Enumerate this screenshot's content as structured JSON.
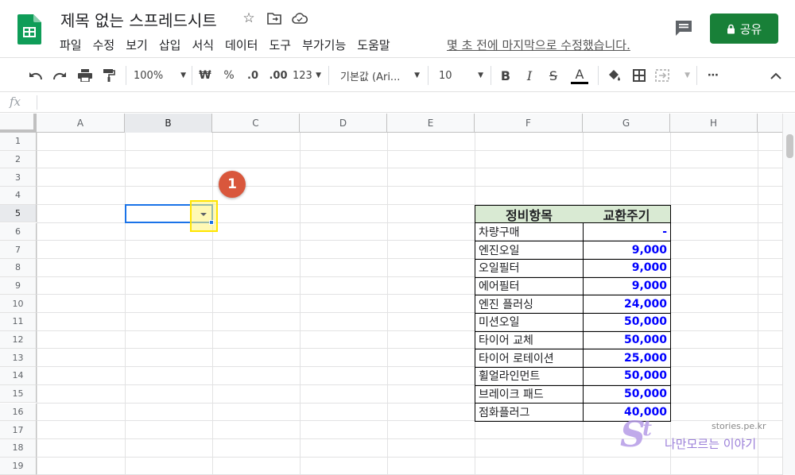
{
  "app": {
    "doc_title": "제목 없는 스프레드시트",
    "last_edit": "몇 초 전에 마지막으로 수정했습니다.",
    "share_label": "공유",
    "menu": [
      "파일",
      "수정",
      "보기",
      "삽입",
      "서식",
      "데이터",
      "도구",
      "부가기능",
      "도움말"
    ]
  },
  "toolbar": {
    "zoom": "100%",
    "currency": "₩",
    "percent": "%",
    "dec_decrease": ".0",
    "dec_increase": ".00",
    "more_formats": "123",
    "font": "기본값 (Ari...",
    "font_size": "10",
    "bold": "B",
    "italic": "I",
    "strike": "S",
    "text_color": "A",
    "more": "⋯"
  },
  "formula_bar": {
    "fx": "fx",
    "value": ""
  },
  "columns": [
    "A",
    "B",
    "C",
    "D",
    "E",
    "F",
    "G",
    "H"
  ],
  "rows": [
    "1",
    "2",
    "3",
    "4",
    "5",
    "6",
    "7",
    "8",
    "9",
    "10",
    "11",
    "12",
    "13",
    "14",
    "15",
    "16",
    "17",
    "18",
    "19"
  ],
  "selected": {
    "column": "B",
    "row": "5"
  },
  "table": {
    "headers": [
      "정비항목",
      "교환주기"
    ],
    "rows": [
      [
        "차량구매",
        "-"
      ],
      [
        "엔진오일",
        "9,000"
      ],
      [
        "오일필터",
        "9,000"
      ],
      [
        "에어필터",
        "9,000"
      ],
      [
        "엔진 플러싱",
        "24,000"
      ],
      [
        "미션오일",
        "50,000"
      ],
      [
        "타이어 교체",
        "50,000"
      ],
      [
        "타이어 로테이션",
        "25,000"
      ],
      [
        "휠얼라인먼트",
        "50,000"
      ],
      [
        "브레이크 패드",
        "50,000"
      ],
      [
        "점화플러그",
        "40,000"
      ]
    ]
  },
  "annotation": {
    "badge": "1"
  },
  "watermark": {
    "url": "stories.pe.kr",
    "text": "나만모르는 이야기",
    "logo_letters": "St"
  },
  "colors": {
    "share_green": "#188038",
    "header_fill": "#d9ead3",
    "number_blue": "#0000ff",
    "selection_blue": "#1a73e8",
    "highlight_yellow": "#ffe500",
    "badge_red": "#d9573c"
  }
}
